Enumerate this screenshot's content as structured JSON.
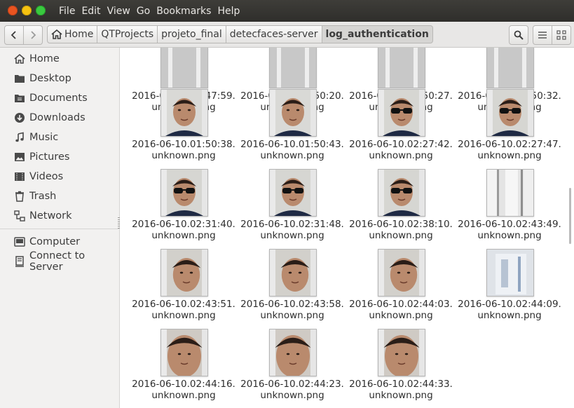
{
  "menubar": {
    "items": [
      "File",
      "Edit",
      "View",
      "Go",
      "Bookmarks",
      "Help"
    ]
  },
  "breadcrumbs": [
    "Home",
    "QTProjects",
    "projeto_final",
    "detecfaces-server",
    "log_authentication"
  ],
  "sidebar": {
    "places": [
      {
        "label": "Home",
        "icon": "home-icon"
      },
      {
        "label": "Desktop",
        "icon": "desktop-folder-icon"
      },
      {
        "label": "Documents",
        "icon": "documents-folder-icon"
      },
      {
        "label": "Downloads",
        "icon": "download-icon"
      },
      {
        "label": "Music",
        "icon": "music-note-icon"
      },
      {
        "label": "Pictures",
        "icon": "pictures-icon"
      },
      {
        "label": "Videos",
        "icon": "video-icon"
      },
      {
        "label": "Trash",
        "icon": "trash-icon"
      },
      {
        "label": "Network",
        "icon": "network-icon"
      }
    ],
    "devices": [
      {
        "label": "Computer",
        "icon": "computer-icon"
      },
      {
        "label": "Connect to Server",
        "icon": "server-icon"
      }
    ]
  },
  "files": [
    {
      "line1": "2016-06-10.01:47:59.",
      "line2": "unknown.png",
      "kind": "strip"
    },
    {
      "line1": "2016-06-10.01:50:20.",
      "line2": "unknown.png",
      "kind": "strip"
    },
    {
      "line1": "2016-06-10.01:50:27.",
      "line2": "unknown.png",
      "kind": "strip"
    },
    {
      "line1": "2016-06-10.01:50:32.",
      "line2": "unknown.png",
      "kind": "strip"
    },
    {
      "line1": "2016-06-10.01:50:38.",
      "line2": "unknown.png",
      "kind": "face"
    },
    {
      "line1": "2016-06-10.01:50:43.",
      "line2": "unknown.png",
      "kind": "face"
    },
    {
      "line1": "2016-06-10.02:27:42.",
      "line2": "unknown.png",
      "kind": "glasses"
    },
    {
      "line1": "2016-06-10.02:27:47.",
      "line2": "unknown.png",
      "kind": "glasses"
    },
    {
      "line1": "2016-06-10.02:31:40.",
      "line2": "unknown.png",
      "kind": "glasses"
    },
    {
      "line1": "2016-06-10.02:31:48.",
      "line2": "unknown.png",
      "kind": "glasses"
    },
    {
      "line1": "2016-06-10.02:38:10.",
      "line2": "unknown.png",
      "kind": "glasses"
    },
    {
      "line1": "2016-06-10.02:43:49.",
      "line2": "unknown.png",
      "kind": "wall"
    },
    {
      "line1": "2016-06-10.02:43:51.",
      "line2": "unknown.png",
      "kind": "tilt"
    },
    {
      "line1": "2016-06-10.02:43:58.",
      "line2": "unknown.png",
      "kind": "tilt"
    },
    {
      "line1": "2016-06-10.02:44:03.",
      "line2": "unknown.png",
      "kind": "tilt"
    },
    {
      "line1": "2016-06-10.02:44:09.",
      "line2": "unknown.png",
      "kind": "blur"
    },
    {
      "line1": "2016-06-10.02:44:16.",
      "line2": "unknown.png",
      "kind": "close"
    },
    {
      "line1": "2016-06-10.02:44:23.",
      "line2": "unknown.png",
      "kind": "close"
    },
    {
      "line1": "2016-06-10.02:44:33.",
      "line2": "unknown.png",
      "kind": "close"
    }
  ],
  "colors": {
    "accent": "#e95420",
    "sidebar_bg": "#f2f1f0",
    "titlebar": "#3c3b37"
  }
}
